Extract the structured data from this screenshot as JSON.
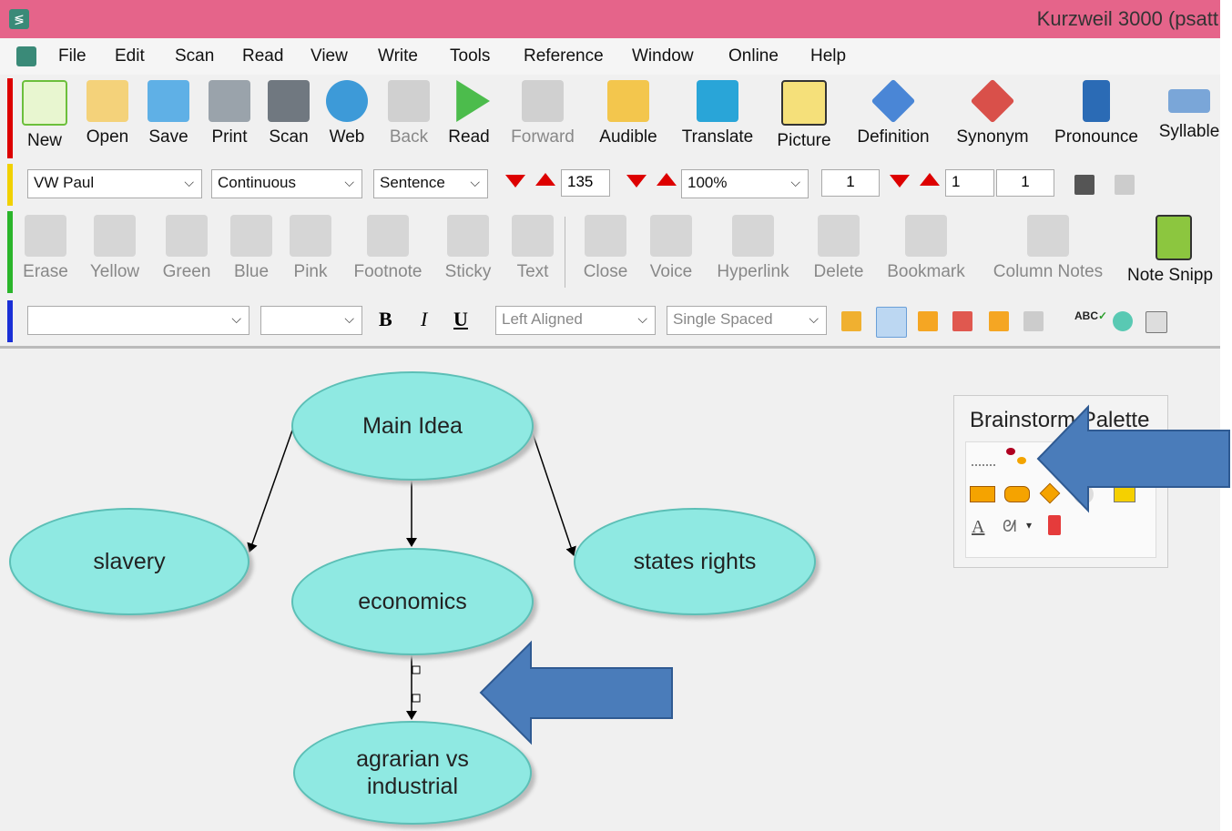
{
  "window": {
    "title": "Kurzweil 3000 (psatt"
  },
  "menu": [
    "File",
    "Edit",
    "Scan",
    "Read",
    "View",
    "Write",
    "Tools",
    "Reference",
    "Window",
    "Online",
    "Help"
  ],
  "toolbar_main": [
    "New",
    "Open",
    "Save",
    "Print",
    "Scan",
    "Web",
    "Back",
    "Read",
    "Forward",
    "Audible",
    "Translate",
    "Picture",
    "Definition",
    "Synonym",
    "Pronounce",
    "Syllable"
  ],
  "reading_bar": {
    "voice": "VW Paul",
    "mode": "Continuous",
    "unit": "Sentence",
    "speed": "135",
    "zoom": "100%",
    "page_left": "1",
    "page_mid": "1",
    "page_right": "1"
  },
  "toolbar_study": [
    "Erase",
    "Yellow",
    "Green",
    "Blue",
    "Pink",
    "Footnote",
    "Sticky",
    "Text",
    "Close",
    "Voice",
    "Hyperlink",
    "Delete",
    "Bookmark",
    "Column Notes",
    "Note Snipp"
  ],
  "format_bar": {
    "font": "",
    "size": "",
    "bold": "B",
    "italic": "I",
    "underline": "U",
    "align": "Left Aligned",
    "spacing": "Single Spaced",
    "spell": "ABC"
  },
  "diagram": {
    "main": "Main Idea",
    "left": "slavery",
    "center": "economics",
    "right": "states rights",
    "bottom": "agrarian vs industrial"
  },
  "palette": {
    "title": "Brainstorm Palette"
  },
  "colors": {
    "titlebar": "#e5648a",
    "node_fill": "#8fe9e2",
    "arrow": "#4a7cba"
  }
}
